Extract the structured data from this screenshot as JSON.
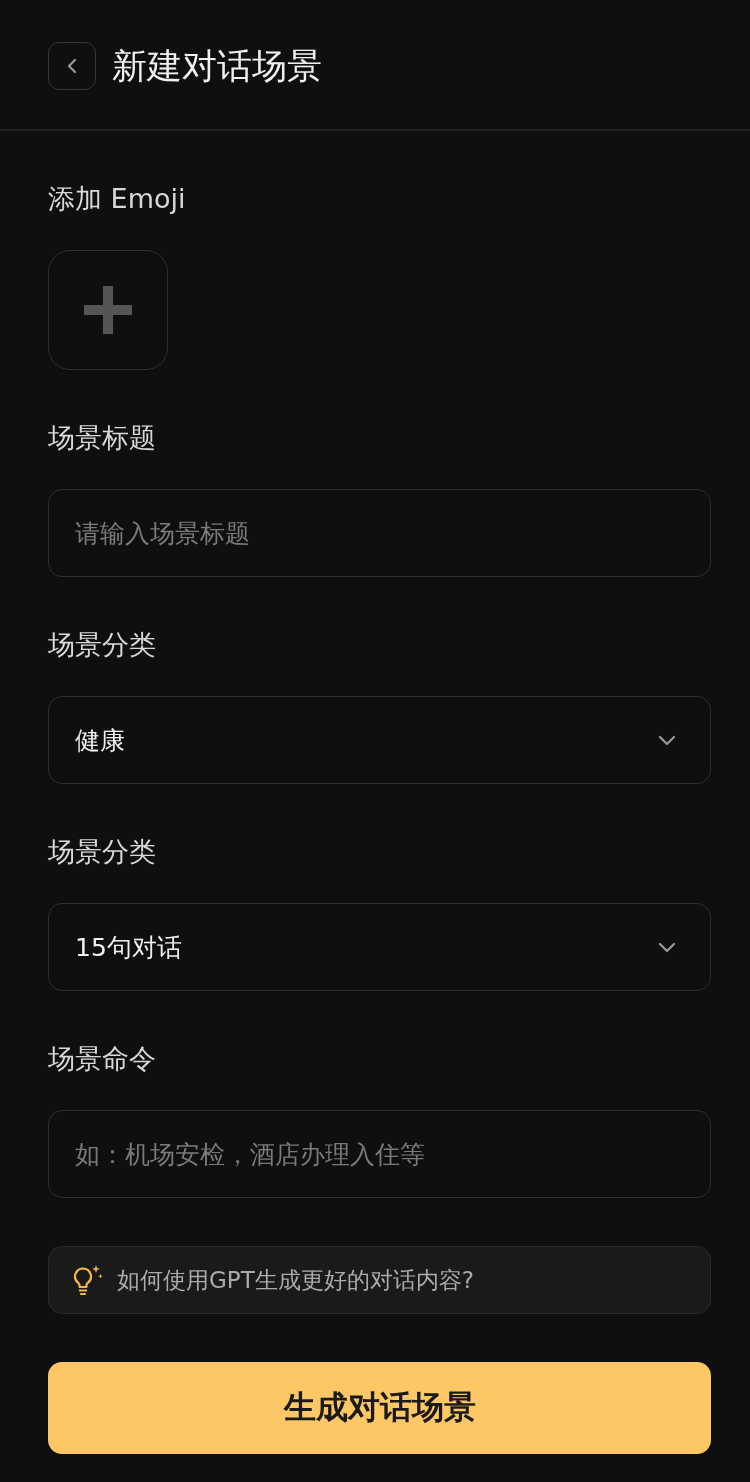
{
  "header": {
    "title": "新建对话场景"
  },
  "form": {
    "fields": [
      {
        "kind": "emoji",
        "label": "添加 Emoji"
      },
      {
        "kind": "text",
        "label": "场景标题",
        "placeholder": "请输入场景标题"
      },
      {
        "kind": "select",
        "label": "场景分类",
        "value": "健康"
      },
      {
        "kind": "select",
        "label": "场景分类",
        "value": "15句对话"
      },
      {
        "kind": "text",
        "label": "场景命令",
        "placeholder": "如：机场安检，酒店办理入住等"
      }
    ]
  },
  "tip": {
    "text": "如何使用GPT生成更好的对话内容?"
  },
  "submit_button": {
    "label": "生成对话场景"
  }
}
